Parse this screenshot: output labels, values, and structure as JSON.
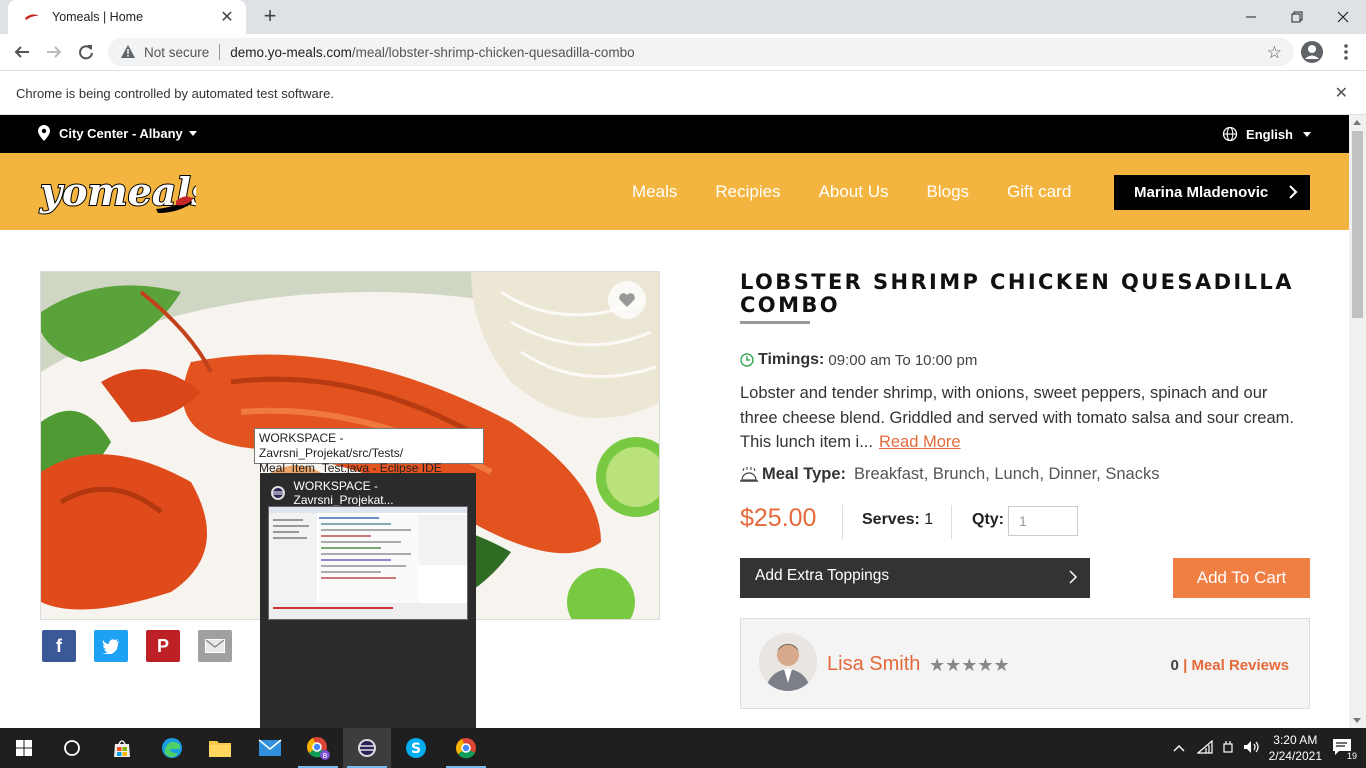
{
  "browser": {
    "tab_title": "Yomeals | Home",
    "tab_close": "✕",
    "new_tab": "+",
    "omnibox_security": "Not secure",
    "url_host": "demo.yo-meals.com",
    "url_path": "/meal/lobster-shrimp-chicken-quesadilla-combo",
    "infobar_text": "Chrome is being controlled by automated test software."
  },
  "site": {
    "location": "City Center - Albany",
    "language": "English",
    "nav": [
      "Meals",
      "Recipies",
      "About Us",
      "Blogs",
      "Gift card"
    ],
    "user": "Marina Mladenovic"
  },
  "meal": {
    "title": "LOBSTER SHRIMP CHICKEN QUESADILLA COMBO",
    "timings_label": "Timings:",
    "timings_value": "09:00 am To 10:00 pm",
    "description": "Lobster and tender shrimp, with onions, sweet peppers, spinach and our three cheese blend. Griddled and served with tomato salsa and sour cream. This lunch item i...",
    "read_more": "Read More",
    "meal_type_label": "Meal Type:",
    "meal_type_value": "Breakfast, Brunch, Lunch, Dinner, Snacks",
    "price": "$25.00",
    "serves_label": "Serves:",
    "serves_value": "1",
    "qty_label": "Qty:",
    "qty_placeholder": "1",
    "toppings_button": "Add Extra Toppings",
    "add_to_cart": "Add To Cart"
  },
  "chef": {
    "name": "Lisa Smith",
    "stars": "★★★★★",
    "rating": 0,
    "review_count": "0",
    "review_sep": "|",
    "reviews_link": "Meal Reviews"
  },
  "tooltip": {
    "line1": "WORKSPACE - Zavrsni_Projekat/src/Tests/",
    "line2": "Meal_Item_Test.java - Eclipse IDE"
  },
  "thumbnail": {
    "title": "WORKSPACE - Zavrsni_Projekat..."
  },
  "taskbar": {
    "time": "3:20 AM",
    "date": "2/24/2021",
    "notification_count": "19"
  },
  "colors": {
    "brand_yellow": "#f3b53f",
    "accent_orange": "#e46a3a",
    "cart_orange": "#f07f44",
    "facebook": "#3b5998",
    "twitter": "#1da1f2",
    "pinterest": "#bd2126",
    "email": "#a0a0a0"
  }
}
